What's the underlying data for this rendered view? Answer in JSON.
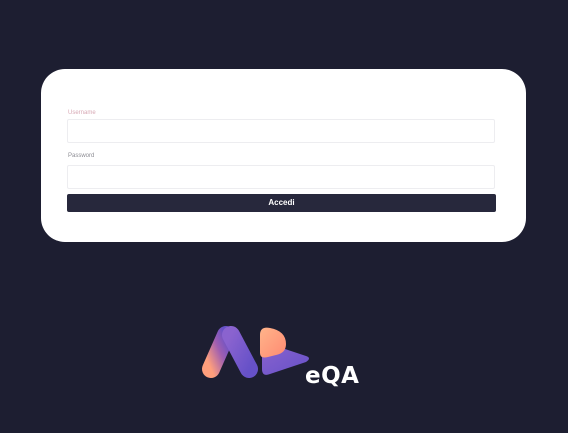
{
  "login_form": {
    "username_label": "Username",
    "username_value": "",
    "password_label": "Password",
    "password_value": "",
    "submit_label": "Accedi"
  },
  "brand": {
    "logo_text": "eQA",
    "colors": {
      "background": "#1d1e31",
      "card": "#ffffff",
      "button": "#27283c",
      "logo_gradient_start": "#ff9f7c",
      "logo_gradient_end": "#6651c8"
    }
  }
}
